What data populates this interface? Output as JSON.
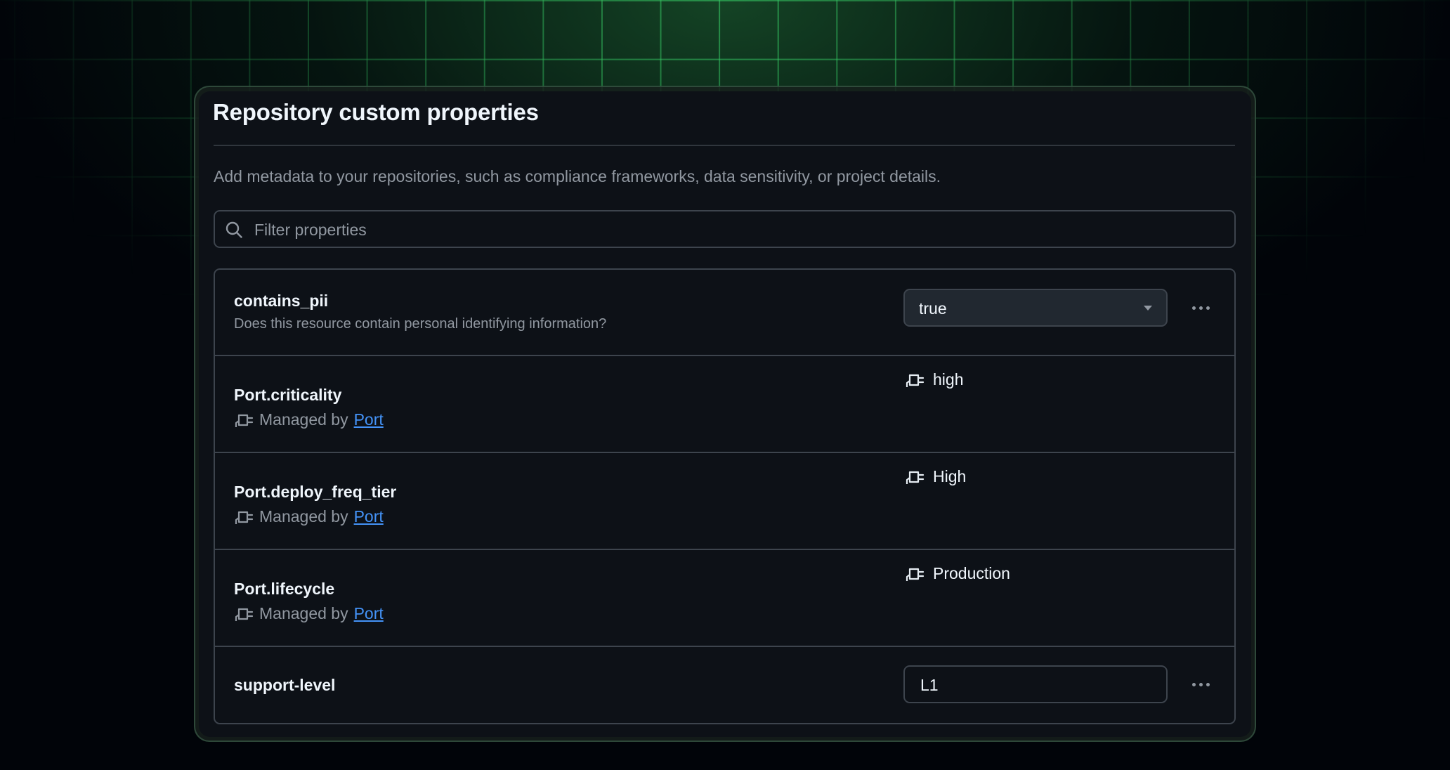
{
  "panel": {
    "title": "Repository custom properties",
    "description": "Add metadata to your repositories, such as compliance frameworks, data sensitivity, or project details.",
    "filter_placeholder": "Filter properties"
  },
  "properties": [
    {
      "name": "contains_pii",
      "description": "Does this resource contain personal identifying information?",
      "control": "select",
      "value": "true"
    },
    {
      "name": "Port.criticality",
      "managed_prefix": "Managed by",
      "managed_link": "Port",
      "value": "high"
    },
    {
      "name": "Port.deploy_freq_tier",
      "managed_prefix": "Managed by",
      "managed_link": "Port",
      "value": "High"
    },
    {
      "name": "Port.lifecycle",
      "managed_prefix": "Managed by",
      "managed_link": "Port",
      "value": "Production"
    },
    {
      "name": "support-level",
      "control": "text",
      "value": "L1"
    }
  ],
  "icons": {
    "search": "search-icon",
    "managed": "plug-icon",
    "dropdown": "chevron-down-icon",
    "more": "kebab-horizontal-icon"
  },
  "colors": {
    "background": "#010409",
    "panel": "#0d1117",
    "border": "#3d444d",
    "text": "#f0f6fc",
    "muted": "#9198a1",
    "link": "#4493f8",
    "grid": "#3cdc6e"
  }
}
